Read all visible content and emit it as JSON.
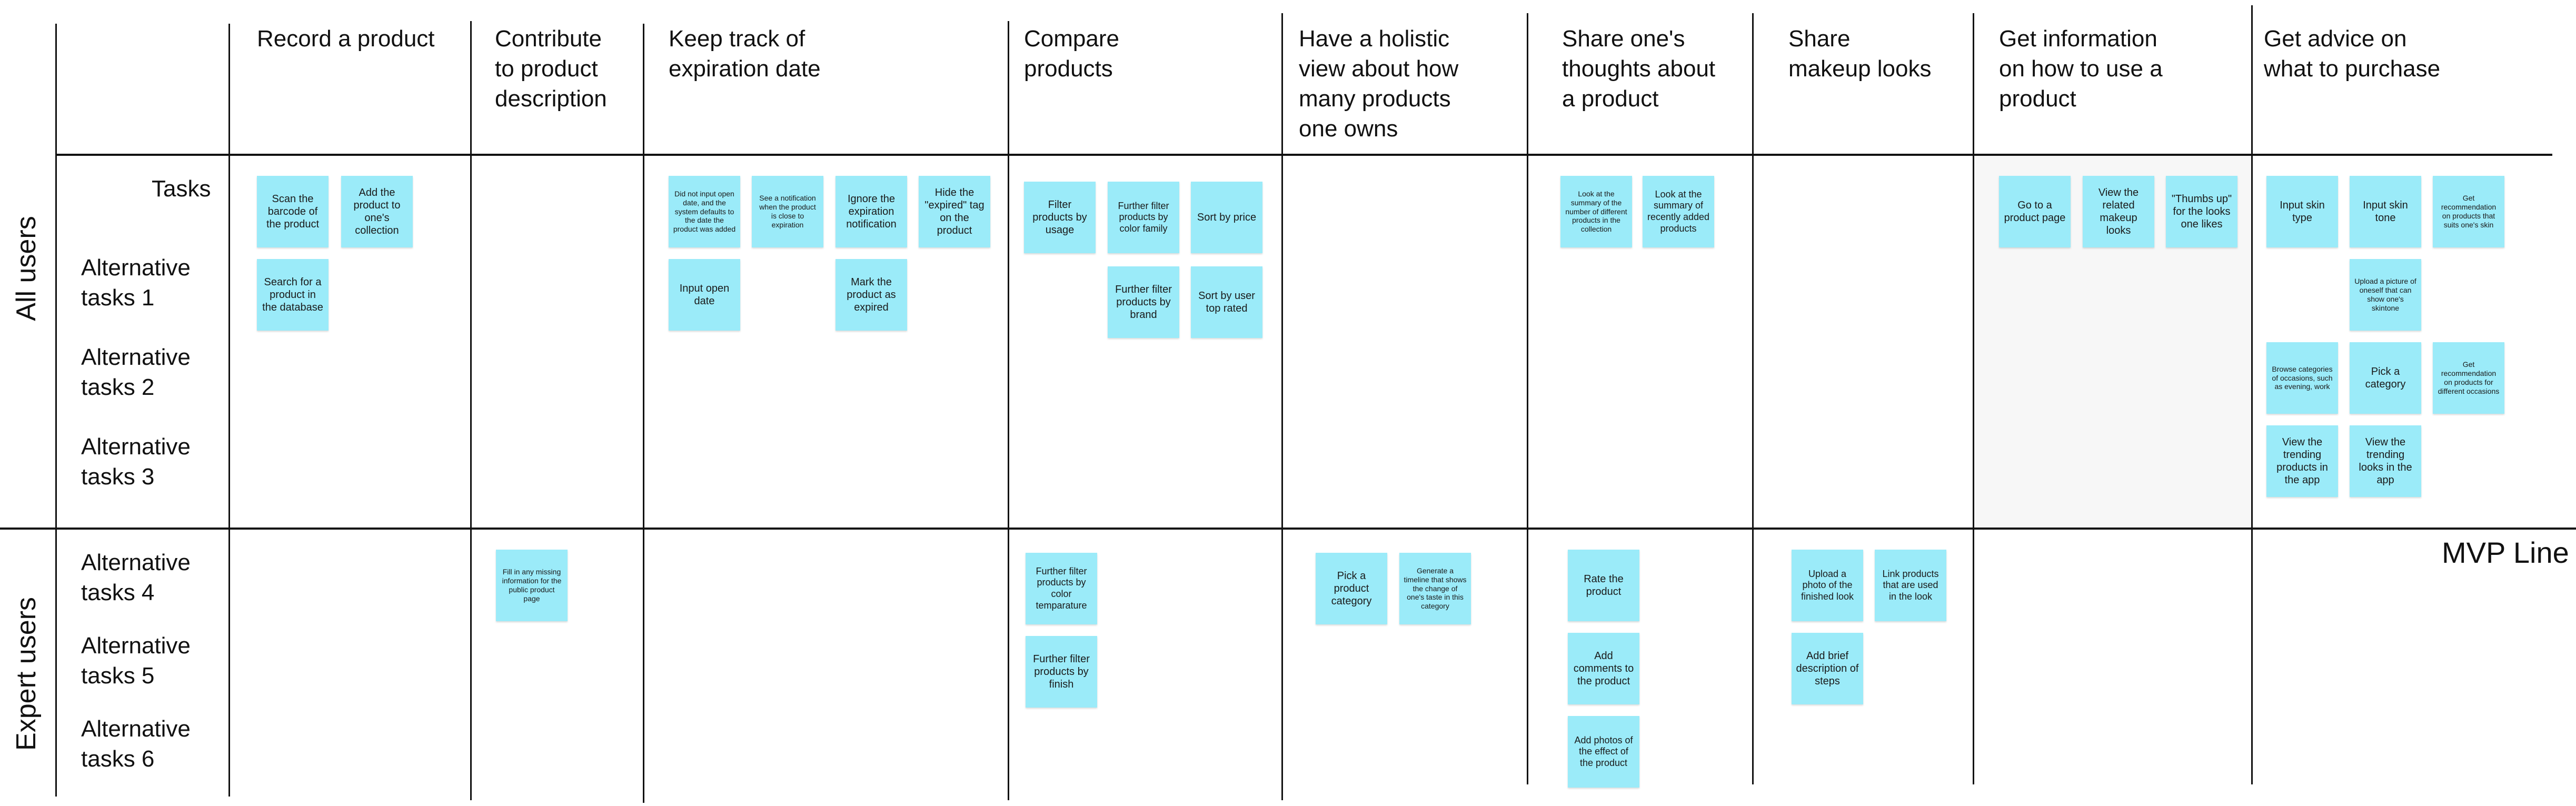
{
  "columns": [
    "Record a product",
    "Contribute\nto product\ndescription",
    "Keep track of\nexpiration date",
    "Compare\nproducts",
    "Have a holistic\nview about how\nmany products\none owns",
    "Share one's\nthoughts about\na product",
    "Share\nmakeup looks",
    "Get information\non how to use a\nproduct",
    "Get advice on\nwhat to purchase"
  ],
  "tasks_label": "Tasks",
  "rows": [
    "Alternative\ntasks 1",
    "Alternative\ntasks 2",
    "Alternative\ntasks 3",
    "Alternative\ntasks 4",
    "Alternative\ntasks 5",
    "Alternative\ntasks 6"
  ],
  "groups": {
    "all_users": "All users",
    "expert_users": "Expert users"
  },
  "mvp_line_label": "MVP Line",
  "sticky_color": "#9bebf9",
  "stickies": [
    {
      "text": "Scan the barcode of the product"
    },
    {
      "text": "Add the product to one's collection"
    },
    {
      "text": "Search for a product in the database"
    },
    {
      "text": "Fill in any missing information for the public product page"
    },
    {
      "text": "Did not input open date, and the system defaults to the date the product was added"
    },
    {
      "text": "See a notification when the product is close to expiration"
    },
    {
      "text": "Ignore the expiration notification"
    },
    {
      "text": "Hide the \"expired\" tag on the product"
    },
    {
      "text": "Input open date"
    },
    {
      "text": "Mark the product as expired"
    },
    {
      "text": "Filter products by usage"
    },
    {
      "text": "Further filter products by color family"
    },
    {
      "text": "Sort by price"
    },
    {
      "text": "Further filter products by brand"
    },
    {
      "text": "Sort by user top rated"
    },
    {
      "text": "Further filter products by color temparature"
    },
    {
      "text": "Further filter products by finish"
    },
    {
      "text": "Pick a product category"
    },
    {
      "text": "Generate a timeline that shows the change of one's taste in this category"
    },
    {
      "text": "Look at the summary of the number of different products in the collection"
    },
    {
      "text": "Look at the summary of recently added products"
    },
    {
      "text": "Rate the product"
    },
    {
      "text": "Add comments to the product"
    },
    {
      "text": "Add photos of the effect of the product"
    },
    {
      "text": "Upload a photo of the finished look"
    },
    {
      "text": "Link products that are used in the look"
    },
    {
      "text": "Add brief description of steps"
    },
    {
      "text": "Go to a product page"
    },
    {
      "text": "View the related makeup looks"
    },
    {
      "text": "\"Thumbs up\" for the looks one likes"
    },
    {
      "text": "Input skin type"
    },
    {
      "text": "Input skin tone"
    },
    {
      "text": "Get recommendation on products that suits one's skin"
    },
    {
      "text": "Upload a picture of oneself that can show one's skintone"
    },
    {
      "text": "Browse categories of occasions, such as evening, work"
    },
    {
      "text": "Pick a category"
    },
    {
      "text": "Get recommendation on products for different occasions"
    },
    {
      "text": "View the trending products in the app"
    },
    {
      "text": "View the trending looks in the app"
    }
  ]
}
